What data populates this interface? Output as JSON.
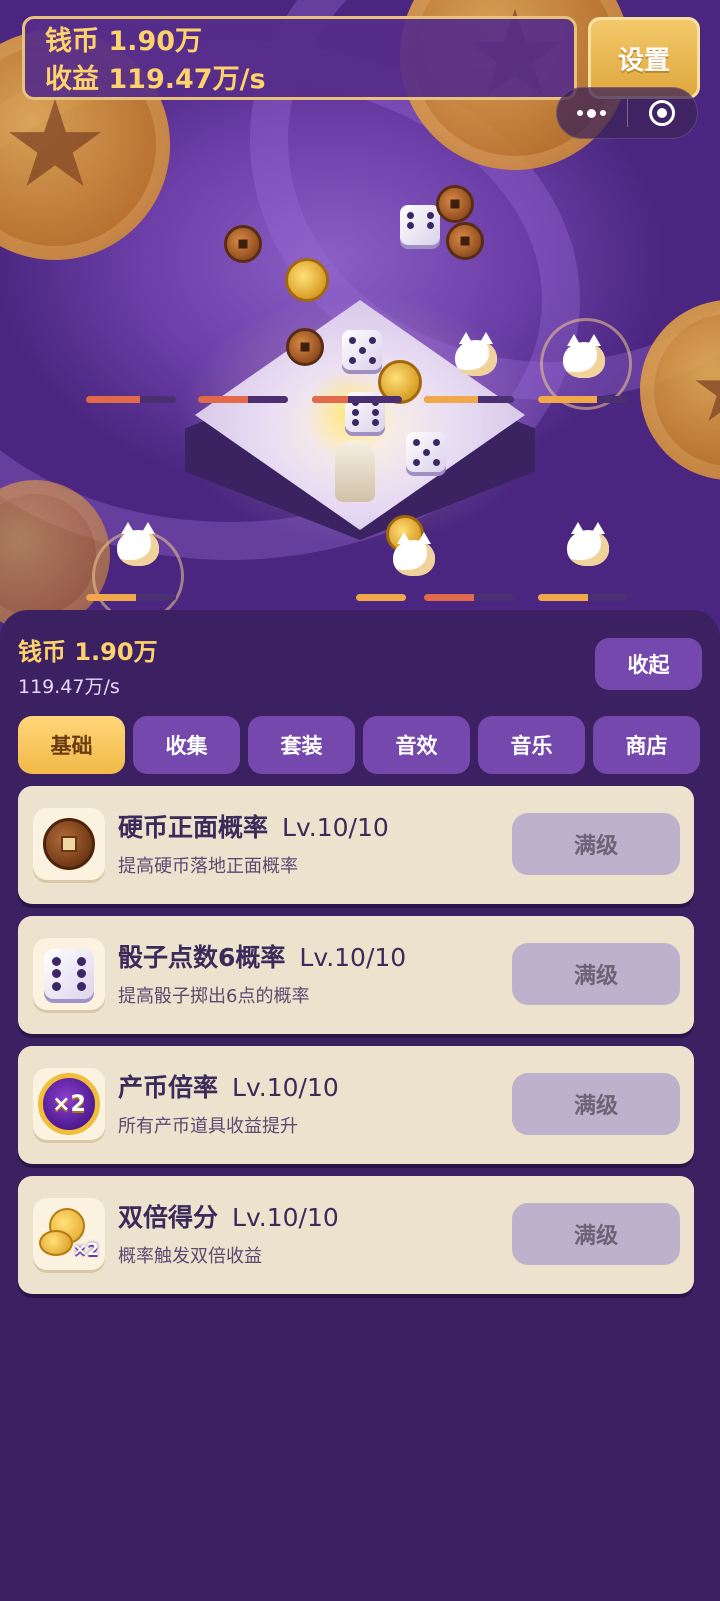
{
  "hud": {
    "coins_line": "钱币 1.90万",
    "income_line": "收益 119.47万/s",
    "settings_label": "设置"
  },
  "panel": {
    "coins_label": "钱币 1.90万",
    "rate_label": "119.47万/s",
    "collapse_label": "收起"
  },
  "tabs": [
    {
      "label": "基础",
      "active": true
    },
    {
      "label": "收集",
      "active": false
    },
    {
      "label": "套装",
      "active": false
    },
    {
      "label": "音效",
      "active": false
    },
    {
      "label": "音乐",
      "active": false
    },
    {
      "label": "商店",
      "active": false
    }
  ],
  "upgrades": [
    {
      "icon": "copper-coin-icon",
      "title": "硬币正面概率",
      "level": "Lv.10/10",
      "desc": "提高硬币落地正面概率",
      "button": "满级"
    },
    {
      "icon": "dice-icon",
      "title": "骰子点数6概率",
      "level": "Lv.10/10",
      "desc": "提高骰子掷出6点的概率",
      "button": "满级"
    },
    {
      "icon": "x2-multiplier-icon",
      "title": "产币倍率",
      "level": "Lv.10/10",
      "desc": "所有产币道具收益提升",
      "button": "满级"
    },
    {
      "icon": "double-coins-icon",
      "title": "双倍得分",
      "level": "Lv.10/10",
      "desc": "概率触发双倍收益",
      "button": "满级"
    }
  ],
  "icon_texts": {
    "x2_badge": "×2",
    "coins_badge": "×2"
  },
  "colors": {
    "panel_bg": "#3b2062",
    "accent_gold": "#ffd36b",
    "tab_bg": "#7448ad",
    "card_bg": "#ede2cd"
  }
}
